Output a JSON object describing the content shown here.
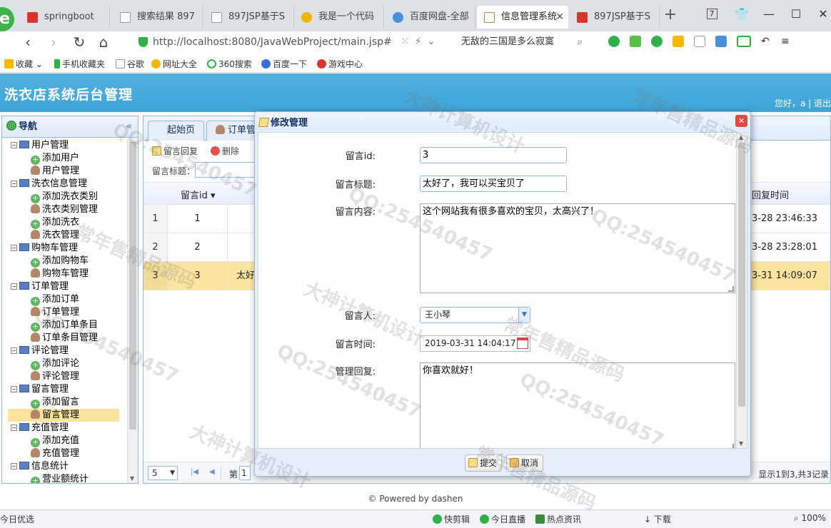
{
  "browser": {
    "tabs": [
      {
        "label": "springboot",
        "color": "#d9352b"
      },
      {
        "label": "搜索结果 897",
        "color": "#cccccc"
      },
      {
        "label": "897JSP基于S",
        "color": "#cccccc"
      },
      {
        "label": "我是一个代码",
        "color": "#f0b400"
      },
      {
        "label": "百度网盘-全部",
        "color": "#4a90d9"
      },
      {
        "label": "信息管理系统",
        "color": "#b08a45",
        "active": true
      },
      {
        "label": "897JSP基于S",
        "color": "#d9352b"
      }
    ],
    "tab_count_badge": "7",
    "url": "http://localhost:8080/JavaWebProject/main.jsp#",
    "search_text": "无敌的三国是多么寂寞",
    "bookmarks": [
      "收藏",
      "手机收藏夹",
      "谷歌",
      "网址大全",
      "360搜索",
      "百度一下",
      "游戏中心"
    ]
  },
  "app": {
    "title": "洗衣店系统后台管理",
    "greeting": "您好，a",
    "logout": "退出"
  },
  "sidebar": {
    "title": "导航",
    "groups": [
      {
        "label": "用户管理",
        "items": [
          "添加用户",
          "用户管理"
        ]
      },
      {
        "label": "洗衣信息管理",
        "items": [
          "添加洗衣类别",
          "洗衣类别管理",
          "添加洗衣",
          "洗衣管理"
        ]
      },
      {
        "label": "购物车管理",
        "items": [
          "添加购物车",
          "购物车管理"
        ]
      },
      {
        "label": "订单管理",
        "items": [
          "添加订单",
          "订单管理",
          "添加订单条目",
          "订单条目管理"
        ]
      },
      {
        "label": "评论管理",
        "items": [
          "添加评论",
          "评论管理"
        ]
      },
      {
        "label": "留言管理",
        "items": [
          "添加留言",
          "留言管理"
        ]
      },
      {
        "label": "充值管理",
        "items": [
          "添加充值",
          "充值管理"
        ]
      },
      {
        "label": "信息统计",
        "items": [
          "营业额统计"
        ]
      }
    ],
    "selected": "留言管理"
  },
  "main": {
    "tabs": [
      "起始页",
      "订单管"
    ],
    "toolbar": {
      "reply": "留言回复",
      "delete": "删除"
    },
    "filter_label": "留言标题：",
    "columns": {
      "id": "留言id",
      "reply_time": "回复时间"
    },
    "rows": [
      {
        "n": "1",
        "id": "1",
        "title": "",
        "time": "3-28 23:46:33"
      },
      {
        "n": "2",
        "id": "2",
        "title": "",
        "time": "3-28 23:28:01"
      },
      {
        "n": "3",
        "id": "3",
        "title": "太好",
        "time": "3-31 14:09:07"
      }
    ],
    "pager": {
      "page_size": "5",
      "page_label": "第",
      "page_num": "1",
      "info": "显示1到3,共3记录"
    }
  },
  "dialog": {
    "title": "修改管理",
    "fields": {
      "id_label": "留言id:",
      "id_value": "3",
      "title_label": "留言标题:",
      "title_value": "太好了，我可以买宝贝了",
      "content_label": "留言内容:",
      "content_value": "这个网站我有很多喜欢的宝贝，太高兴了！",
      "user_label": "留言人:",
      "user_value": "王小琴",
      "time_label": "留言时间:",
      "time_value": "2019-03-31 14:04:17",
      "reply_label": "管理回复:",
      "reply_value": "你喜欢就好！"
    },
    "submit": "提交",
    "cancel": "取消"
  },
  "footer": "© Powered by dashen",
  "statusbar": [
    "今日优选",
    "快剪辑",
    "今日直播",
    "热点资讯",
    "下载",
    "100%"
  ],
  "watermark": [
    "QQ:254540457",
    "大神计算机设计",
    "常年售精品源码"
  ]
}
